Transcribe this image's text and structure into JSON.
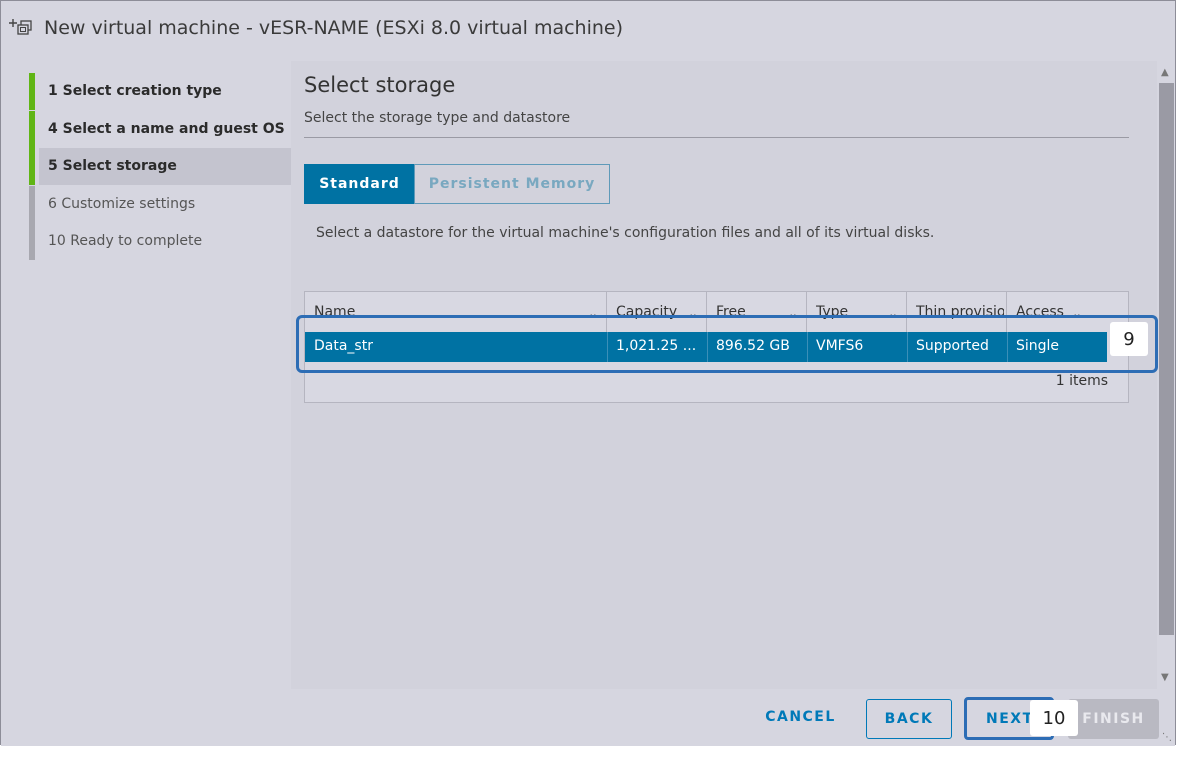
{
  "window": {
    "title": "New virtual machine - vESR-NAME (ESXi 8.0 virtual machine)",
    "icon": "new-vm-icon"
  },
  "wizard": {
    "steps": [
      {
        "label": "1   Select creation type",
        "state": "done"
      },
      {
        "label": "4   Select a name and guest OS",
        "state": "done"
      },
      {
        "label": "5   Select storage",
        "state": "active"
      },
      {
        "label": "6   Customize settings",
        "state": "todo"
      },
      {
        "label": "10    Ready to complete",
        "state": "todo"
      }
    ]
  },
  "page": {
    "title": "Select storage",
    "subtitle": "Select the storage type and datastore",
    "tabs": [
      {
        "label": "Standard",
        "selected": true
      },
      {
        "label": "Persistent Memory",
        "selected": false
      }
    ],
    "description": "Select a datastore for the virtual machine's configuration files and all of its virtual disks."
  },
  "datastore_grid": {
    "columns": [
      "Name",
      "Capacity",
      "Free",
      "Type",
      "Thin provisioning",
      "Access"
    ],
    "rows": [
      {
        "name": "Data_str",
        "capacity": "1,021.25 ...",
        "free": "896.52 GB",
        "type": "VMFS6",
        "thin": "Supported",
        "access": "Single",
        "selected": true
      }
    ],
    "footer": "1 items"
  },
  "annotations": {
    "badge_row": "9",
    "badge_next": "10"
  },
  "footer": {
    "cancel": "CANCEL",
    "back": "BACK",
    "next": "NEXT",
    "finish": "FINISH"
  },
  "colors": {
    "accent": "#0072a3",
    "step_done": "#60b515",
    "highlight": "#2d6db5"
  }
}
